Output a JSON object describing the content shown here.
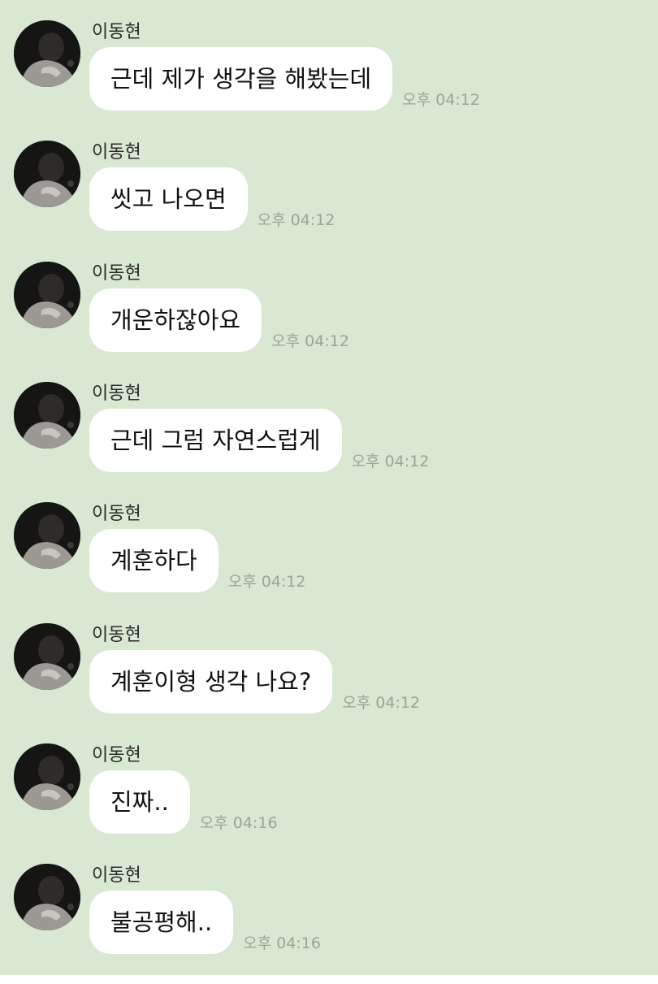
{
  "chat": {
    "messages": [
      {
        "sender": "이동현",
        "text": "근데 제가 생각을 해봤는데",
        "time": "오후 04:12"
      },
      {
        "sender": "이동현",
        "text": "씻고 나오면",
        "time": "오후 04:12"
      },
      {
        "sender": "이동현",
        "text": "개운하잖아요",
        "time": "오후 04:12"
      },
      {
        "sender": "이동현",
        "text": "근데 그럼 자연스럽게",
        "time": "오후 04:12"
      },
      {
        "sender": "이동현",
        "text": "계훈하다",
        "time": "오후 04:12"
      },
      {
        "sender": "이동현",
        "text": "계훈이형 생각 나요?",
        "time": "오후 04:12"
      },
      {
        "sender": "이동현",
        "text": "진짜..",
        "time": "오후 04:16"
      },
      {
        "sender": "이동현",
        "text": "불공평해..",
        "time": "오후 04:16"
      }
    ]
  },
  "colors": {
    "background": "#d8e8d3",
    "bubble": "#ffffff",
    "timestamp": "#9aa594",
    "avatar_background": "#151514"
  },
  "icons": {
    "avatar": "profile-photo-avatar"
  }
}
